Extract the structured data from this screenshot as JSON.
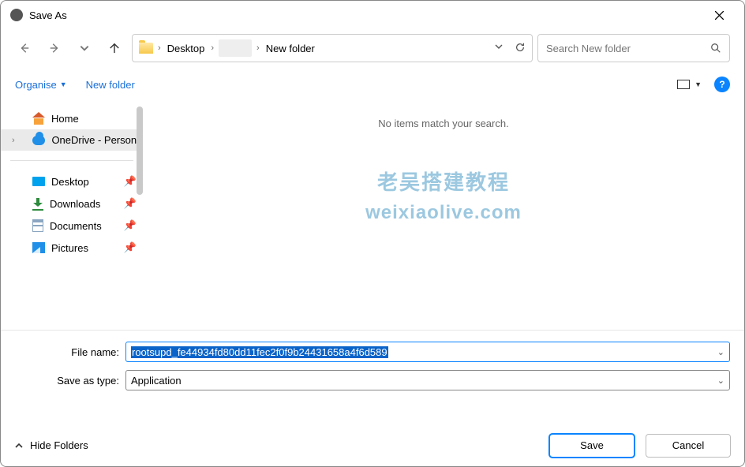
{
  "window": {
    "title": "Save As"
  },
  "breadcrumb": {
    "part1": "Desktop",
    "part2": "New folder"
  },
  "search": {
    "placeholder": "Search New folder"
  },
  "commands": {
    "organise": "Organise",
    "new_folder": "New folder"
  },
  "sidebar": {
    "home": "Home",
    "onedrive": "OneDrive - Personal",
    "desktop": "Desktop",
    "downloads": "Downloads",
    "documents": "Documents",
    "pictures": "Pictures"
  },
  "content": {
    "empty": "No items match your search."
  },
  "watermark": {
    "l1": "老吴搭建教程",
    "l2": "weixiaolive.com"
  },
  "form": {
    "filename_label": "File name:",
    "filename_value": "rootsupd_fe44934fd80dd11fec2f0f9b24431658a4f6d589",
    "type_label": "Save as type:",
    "type_value": "Application"
  },
  "footer": {
    "hide_folders": "Hide Folders",
    "save": "Save",
    "cancel": "Cancel"
  }
}
